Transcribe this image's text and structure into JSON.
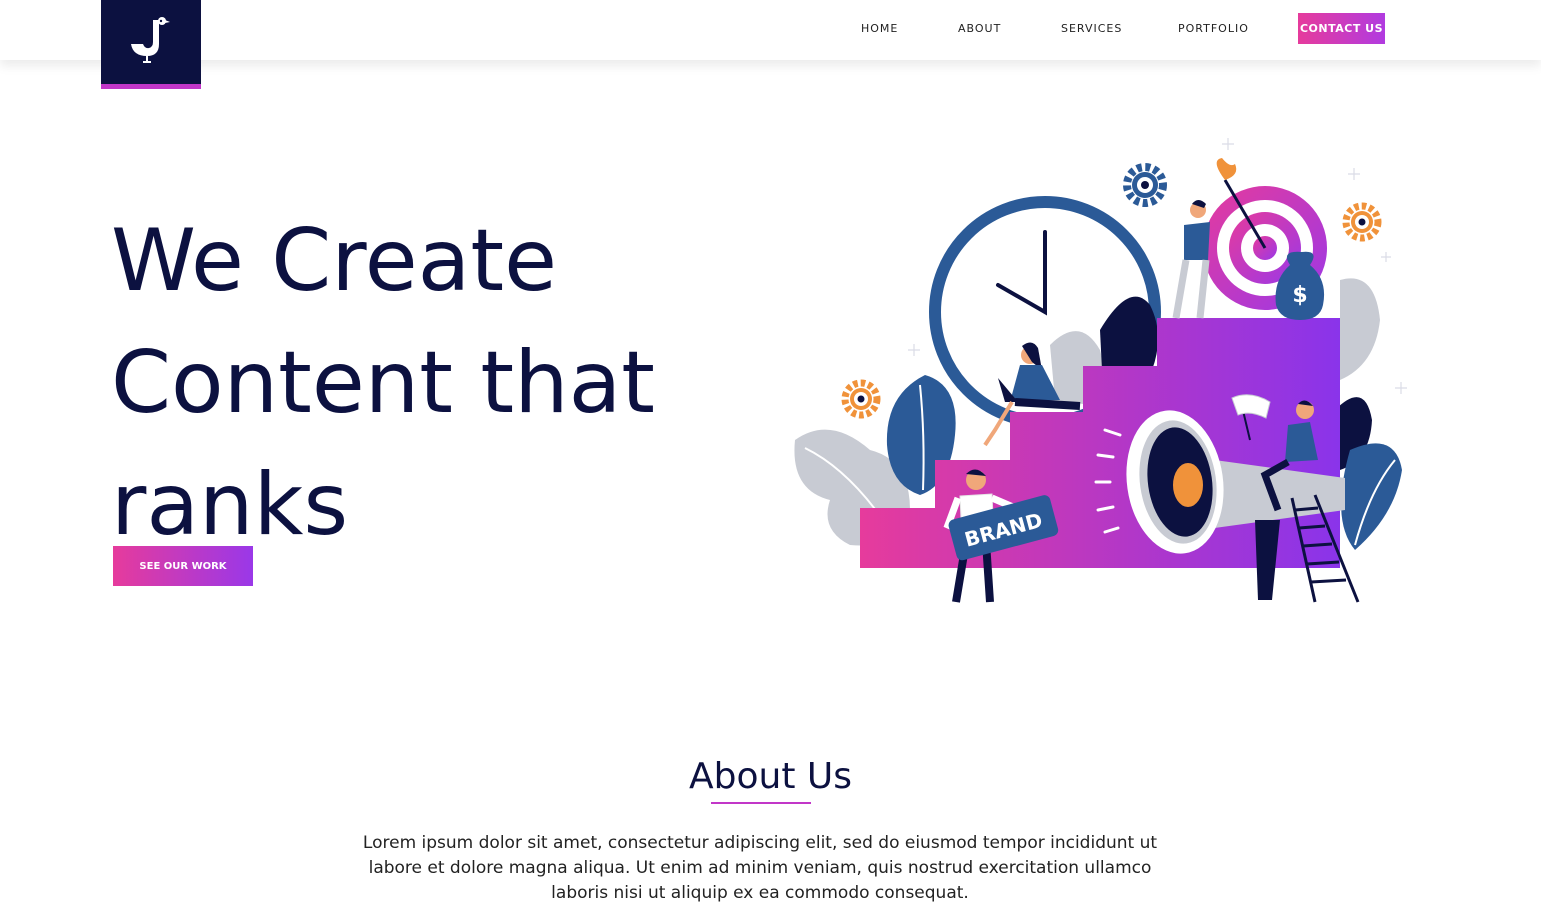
{
  "header": {
    "nav": [
      {
        "label": "HOME"
      },
      {
        "label": "ABOUT"
      },
      {
        "label": "SERVICES"
      },
      {
        "label": "PORTFOLIO"
      }
    ],
    "contact_label": "CONTACT US"
  },
  "hero": {
    "title": "We Create Content that ranks",
    "button_label": "SEE OUR WORK",
    "illustration": {
      "brand_sign_text": "BRAND",
      "money_symbol": "$"
    }
  },
  "about": {
    "title": "About Us",
    "text": "Lorem ipsum dolor sit amet, consectetur adipiscing elit, sed do eiusmod tempor incididunt ut labore et dolore magna aliqua. Ut enim ad minim veniam, quis nostrud exercitation ullamco laboris nisi ut aliquip ex ea commodo consequat."
  },
  "colors": {
    "navy": "#0c1140",
    "pink": "#e63b9c",
    "purple": "#9a38e8",
    "blue": "#2b5a97",
    "orange": "#f0923a"
  }
}
